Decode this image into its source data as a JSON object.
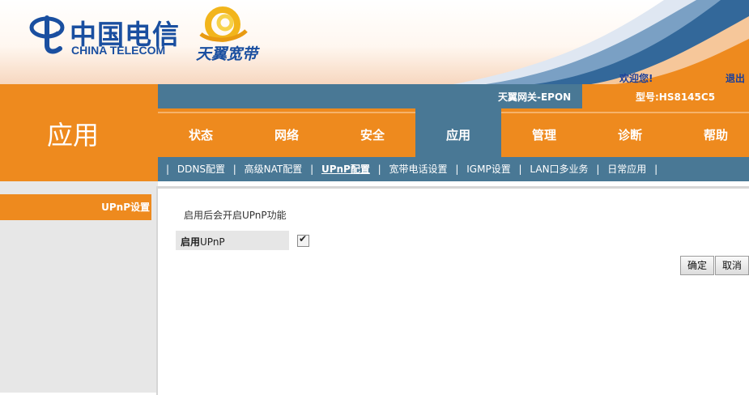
{
  "header": {
    "china_telecom_cn": "中国电信",
    "china_telecom_en": "CHINA TELECOM",
    "tianyi_text": "天翼宽带",
    "welcome": "欢迎您!",
    "logout": "退出"
  },
  "info_bar": {
    "gateway": "天翼网关-EPON",
    "model": "型号:HS8145C5"
  },
  "section_title": "应用",
  "main_nav": [
    {
      "label": "状态",
      "active": false
    },
    {
      "label": "网络",
      "active": false
    },
    {
      "label": "安全",
      "active": false
    },
    {
      "label": "应用",
      "active": true
    },
    {
      "label": "管理",
      "active": false
    },
    {
      "label": "诊断",
      "active": false
    },
    {
      "label": "帮助",
      "active": false
    }
  ],
  "sub_nav": {
    "separator": "|",
    "items": [
      {
        "label": "DDNS配置",
        "active": false
      },
      {
        "label": "高级NAT配置",
        "active": false
      },
      {
        "label": "UPnP配置",
        "active": true
      },
      {
        "label": "宽带电话设置",
        "active": false
      },
      {
        "label": "IGMP设置",
        "active": false
      },
      {
        "label": "LAN口多业务",
        "active": false
      },
      {
        "label": "日常应用",
        "active": false
      }
    ]
  },
  "sidebar": {
    "item": "UPnP设置"
  },
  "content": {
    "description": "启用后会开启UPnP功能",
    "upnp_label_bold": "启用",
    "upnp_label": "UPnP",
    "upnp_checked": true,
    "ok_button": "确定",
    "cancel_button": "取消"
  },
  "colors": {
    "orange": "#ee8a1e",
    "steel_blue": "#497895",
    "logo_blue": "#1a4fa0"
  }
}
